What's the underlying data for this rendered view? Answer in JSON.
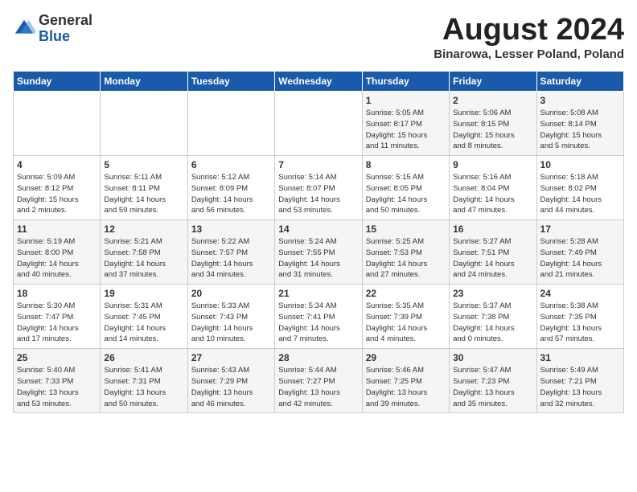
{
  "header": {
    "logo_general": "General",
    "logo_blue": "Blue",
    "month_title": "August 2024",
    "subtitle": "Binarowa, Lesser Poland, Poland"
  },
  "days_of_week": [
    "Sunday",
    "Monday",
    "Tuesday",
    "Wednesday",
    "Thursday",
    "Friday",
    "Saturday"
  ],
  "weeks": [
    [
      {
        "day": "",
        "text": ""
      },
      {
        "day": "",
        "text": ""
      },
      {
        "day": "",
        "text": ""
      },
      {
        "day": "",
        "text": ""
      },
      {
        "day": "1",
        "text": "Sunrise: 5:05 AM\nSunset: 8:17 PM\nDaylight: 15 hours\nand 11 minutes."
      },
      {
        "day": "2",
        "text": "Sunrise: 5:06 AM\nSunset: 8:15 PM\nDaylight: 15 hours\nand 8 minutes."
      },
      {
        "day": "3",
        "text": "Sunrise: 5:08 AM\nSunset: 8:14 PM\nDaylight: 15 hours\nand 5 minutes."
      }
    ],
    [
      {
        "day": "4",
        "text": "Sunrise: 5:09 AM\nSunset: 8:12 PM\nDaylight: 15 hours\nand 2 minutes."
      },
      {
        "day": "5",
        "text": "Sunrise: 5:11 AM\nSunset: 8:11 PM\nDaylight: 14 hours\nand 59 minutes."
      },
      {
        "day": "6",
        "text": "Sunrise: 5:12 AM\nSunset: 8:09 PM\nDaylight: 14 hours\nand 56 minutes."
      },
      {
        "day": "7",
        "text": "Sunrise: 5:14 AM\nSunset: 8:07 PM\nDaylight: 14 hours\nand 53 minutes."
      },
      {
        "day": "8",
        "text": "Sunrise: 5:15 AM\nSunset: 8:05 PM\nDaylight: 14 hours\nand 50 minutes."
      },
      {
        "day": "9",
        "text": "Sunrise: 5:16 AM\nSunset: 8:04 PM\nDaylight: 14 hours\nand 47 minutes."
      },
      {
        "day": "10",
        "text": "Sunrise: 5:18 AM\nSunset: 8:02 PM\nDaylight: 14 hours\nand 44 minutes."
      }
    ],
    [
      {
        "day": "11",
        "text": "Sunrise: 5:19 AM\nSunset: 8:00 PM\nDaylight: 14 hours\nand 40 minutes."
      },
      {
        "day": "12",
        "text": "Sunrise: 5:21 AM\nSunset: 7:58 PM\nDaylight: 14 hours\nand 37 minutes."
      },
      {
        "day": "13",
        "text": "Sunrise: 5:22 AM\nSunset: 7:57 PM\nDaylight: 14 hours\nand 34 minutes."
      },
      {
        "day": "14",
        "text": "Sunrise: 5:24 AM\nSunset: 7:55 PM\nDaylight: 14 hours\nand 31 minutes."
      },
      {
        "day": "15",
        "text": "Sunrise: 5:25 AM\nSunset: 7:53 PM\nDaylight: 14 hours\nand 27 minutes."
      },
      {
        "day": "16",
        "text": "Sunrise: 5:27 AM\nSunset: 7:51 PM\nDaylight: 14 hours\nand 24 minutes."
      },
      {
        "day": "17",
        "text": "Sunrise: 5:28 AM\nSunset: 7:49 PM\nDaylight: 14 hours\nand 21 minutes."
      }
    ],
    [
      {
        "day": "18",
        "text": "Sunrise: 5:30 AM\nSunset: 7:47 PM\nDaylight: 14 hours\nand 17 minutes."
      },
      {
        "day": "19",
        "text": "Sunrise: 5:31 AM\nSunset: 7:45 PM\nDaylight: 14 hours\nand 14 minutes."
      },
      {
        "day": "20",
        "text": "Sunrise: 5:33 AM\nSunset: 7:43 PM\nDaylight: 14 hours\nand 10 minutes."
      },
      {
        "day": "21",
        "text": "Sunrise: 5:34 AM\nSunset: 7:41 PM\nDaylight: 14 hours\nand 7 minutes."
      },
      {
        "day": "22",
        "text": "Sunrise: 5:35 AM\nSunset: 7:39 PM\nDaylight: 14 hours\nand 4 minutes."
      },
      {
        "day": "23",
        "text": "Sunrise: 5:37 AM\nSunset: 7:38 PM\nDaylight: 14 hours\nand 0 minutes."
      },
      {
        "day": "24",
        "text": "Sunrise: 5:38 AM\nSunset: 7:35 PM\nDaylight: 13 hours\nand 57 minutes."
      }
    ],
    [
      {
        "day": "25",
        "text": "Sunrise: 5:40 AM\nSunset: 7:33 PM\nDaylight: 13 hours\nand 53 minutes."
      },
      {
        "day": "26",
        "text": "Sunrise: 5:41 AM\nSunset: 7:31 PM\nDaylight: 13 hours\nand 50 minutes."
      },
      {
        "day": "27",
        "text": "Sunrise: 5:43 AM\nSunset: 7:29 PM\nDaylight: 13 hours\nand 46 minutes."
      },
      {
        "day": "28",
        "text": "Sunrise: 5:44 AM\nSunset: 7:27 PM\nDaylight: 13 hours\nand 42 minutes."
      },
      {
        "day": "29",
        "text": "Sunrise: 5:46 AM\nSunset: 7:25 PM\nDaylight: 13 hours\nand 39 minutes."
      },
      {
        "day": "30",
        "text": "Sunrise: 5:47 AM\nSunset: 7:23 PM\nDaylight: 13 hours\nand 35 minutes."
      },
      {
        "day": "31",
        "text": "Sunrise: 5:49 AM\nSunset: 7:21 PM\nDaylight: 13 hours\nand 32 minutes."
      }
    ]
  ]
}
